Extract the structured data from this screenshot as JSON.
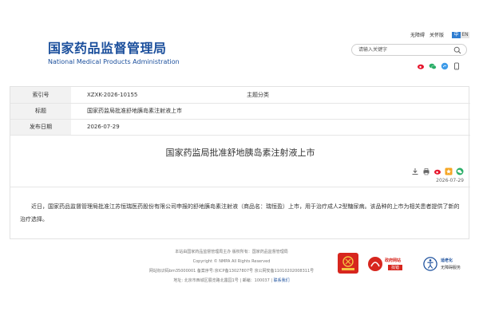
{
  "header": {
    "logo_cn": "国家药品监督管理局",
    "logo_en": "National Medical Products Administration",
    "links": [
      "无障碍",
      "关怀版"
    ],
    "lang_cn": "中",
    "lang_en": "EN",
    "search_placeholder": "请输入关键字"
  },
  "meta": {
    "index_label": "索引号",
    "index_value": "XZXK-2026-10155",
    "category_label": "主题分类",
    "category_value": "",
    "title_label": "标题",
    "title_value": "国家药监局批准舒地胰岛素注射液上市",
    "date_label": "发布日期",
    "date_value": "2026-07-29"
  },
  "article": {
    "title": "国家药监局批准舒地胰岛素注射液上市",
    "date": "2026-07-29",
    "body": "近日，国家药品监督管理局批准江苏恒瑞医药股份有限公司申报的舒地胰岛素注射液（商品名：瑞恒盈）上市，用于治疗成人2型糖尿病。该品种的上市为相关患者提供了新的治疗选择。"
  },
  "footer": {
    "line1": "本站由国家药品监督管理局主办 版权所有：国家药品监督管理局",
    "line2": "Copyright © NMPA All Rights Reserved",
    "line3": "网站标识码bm35000001  备案序号:京ICP备13027807号  京公网安备11010202008311号",
    "line4_prefix": "地址: 北京市西城区展览路北露园1号 | 邮编：100037 |",
    "line4_link": "联系我们",
    "gov_badge_title": "政府网站",
    "gov_badge_sub": "找错",
    "access_title": "适老化",
    "access_sub": "无障碍服务"
  },
  "colors": {
    "brand": "#1b4f9c",
    "badge_red": "#d7261e",
    "accent_blue": "#2f7dd1"
  }
}
